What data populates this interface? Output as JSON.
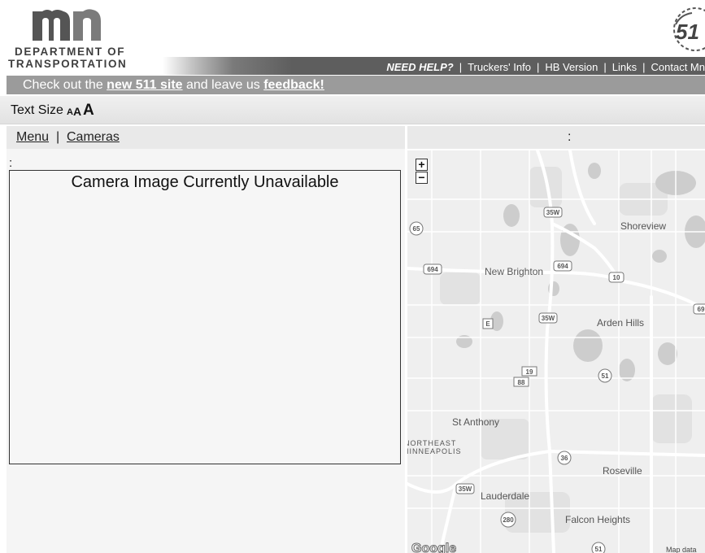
{
  "header": {
    "logo_text": "mn",
    "dept_line1": "DEPARTMENT OF",
    "dept_line2": "TRANSPORTATION",
    "badge_text": "51"
  },
  "helpbar": {
    "need_help": "NEED HELP?",
    "links": [
      "Truckers' Info",
      "HB Version",
      "Links",
      "Contact Mn"
    ]
  },
  "notice": {
    "prefix": "Check out the ",
    "link1": "new 511 site",
    "middle": " and leave us ",
    "link2": "feedback!"
  },
  "text_size": {
    "label": "Text Size",
    "small": "A",
    "medium": "A",
    "large": "A"
  },
  "nav": {
    "menu": "Menu",
    "separator": "|",
    "cameras": "Cameras"
  },
  "camera": {
    "title_colon": ":",
    "message": "Camera Image Currently Unavailable"
  },
  "map": {
    "header_colon": ":",
    "zoom_in": "+",
    "zoom_out": "−",
    "places": [
      "Shoreview",
      "New Brighton",
      "Arden Hills",
      "St Anthony",
      "NORTHEAST",
      "MINNEAPOLIS",
      "Roseville",
      "Lauderdale",
      "Falcon Heights"
    ],
    "shields": [
      "35W",
      "65",
      "694",
      "694",
      "10",
      "35W",
      "E",
      "19",
      "88",
      "51",
      "69",
      "36",
      "35W",
      "280",
      "51"
    ],
    "google_logo": "Google",
    "attribution": "Map data"
  },
  "colors": {
    "helpbar": "#5e5e5e",
    "notice_bg": "#9b9b9b",
    "map_bg": "#f0f0f0",
    "road": "#ffffff"
  }
}
